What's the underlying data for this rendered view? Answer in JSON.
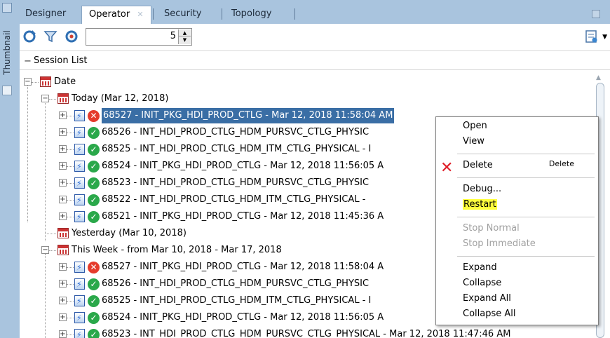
{
  "tabs": [
    {
      "label": "Designer"
    },
    {
      "label": "Operator",
      "active": true
    },
    {
      "label": "Security"
    },
    {
      "label": "Topology"
    }
  ],
  "side": {
    "thumbnail_label": "Thumbnail"
  },
  "toolbar": {
    "count_value": "5"
  },
  "section": {
    "title": "Session List"
  },
  "tree": {
    "root": "Date",
    "today": "Today (Mar 12, 2018)",
    "yesterday": "Yesterday (Mar 10, 2018)",
    "this_week": "This Week - from Mar 10, 2018 - Mar 17, 2018",
    "today_sessions": [
      {
        "status": "error",
        "text": "68527 - INIT_PKG_HDI_PROD_CTLG - Mar 12, 2018 11:58:04 AM"
      },
      {
        "status": "ok",
        "text": "68526 - INT_HDI_PROD_CTLG_HDM_PURSVC_CTLG_PHYSIC"
      },
      {
        "status": "ok",
        "text": "68525 - INT_HDI_PROD_CTLG_HDM_ITM_CTLG_PHYSICAL - I"
      },
      {
        "status": "ok",
        "text": "68524 - INIT_PKG_HDI_PROD_CTLG - Mar 12, 2018 11:56:05 A"
      },
      {
        "status": "ok",
        "text": "68523 - INT_HDI_PROD_CTLG_HDM_PURSVC_CTLG_PHYSIC"
      },
      {
        "status": "ok",
        "text": "68522 - INT_HDI_PROD_CTLG_HDM_ITM_CTLG_PHYSICAL -"
      },
      {
        "status": "ok",
        "text": "68521 - INIT_PKG_HDI_PROD_CTLG - Mar 12, 2018 11:45:36 A"
      }
    ],
    "week_sessions": [
      {
        "status": "error",
        "text": "68527 - INIT_PKG_HDI_PROD_CTLG - Mar 12, 2018 11:58:04 A"
      },
      {
        "status": "ok",
        "text": "68526 - INT_HDI_PROD_CTLG_HDM_PURSVC_CTLG_PHYSIC"
      },
      {
        "status": "ok",
        "text": "68525 - INT_HDI_PROD_CTLG_HDM_ITM_CTLG_PHYSICAL - I"
      },
      {
        "status": "ok",
        "text": "68524 - INIT_PKG_HDI_PROD_CTLG - Mar 12, 2018 11:56:05 A"
      },
      {
        "status": "ok",
        "text": "68523 - INT_HDI_PROD_CTLG_HDM_PURSVC_CTLG_PHYSICAL - Mar 12, 2018 11:47:46 AM"
      }
    ]
  },
  "context_menu": {
    "open": "Open",
    "view": "View",
    "delete": "Delete",
    "delete_accel": "Delete",
    "debug": "Debug...",
    "restart": "Restart",
    "stop_normal": "Stop Normal",
    "stop_immediate": "Stop Immediate",
    "expand": "Expand",
    "collapse": "Collapse",
    "expand_all": "Expand All",
    "collapse_all": "Collapse All"
  },
  "colors": {
    "selection": "#3a6ea5",
    "restart_highlight": "#ffff3c",
    "error": "#e53b2c",
    "success": "#2aa84a"
  }
}
